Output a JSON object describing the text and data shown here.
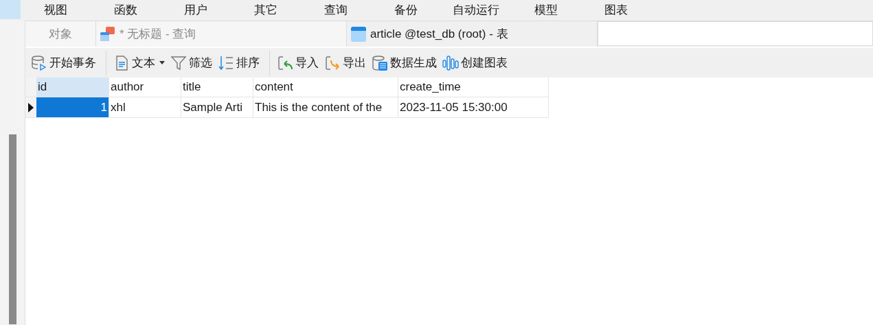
{
  "menu": [
    "视图",
    "函数",
    "用户",
    "其它",
    "查询",
    "备份",
    "自动运行",
    "模型",
    "图表"
  ],
  "tabs": [
    {
      "label": "对象",
      "kind": "plain",
      "selected": false
    },
    {
      "label": "* 无标题 - 查询",
      "kind": "query",
      "selected": false
    },
    {
      "label": "article @test_db (root) - 表",
      "kind": "table",
      "selected": true
    }
  ],
  "toolbar": [
    {
      "label": "开始事务",
      "kind": "transaction"
    },
    {
      "kind": "sep"
    },
    {
      "label": "文本",
      "kind": "text",
      "dropdown": true
    },
    {
      "label": "筛选",
      "kind": "filter"
    },
    {
      "label": "排序",
      "kind": "sort"
    },
    {
      "kind": "sep"
    },
    {
      "label": "导入",
      "kind": "import"
    },
    {
      "label": "导出",
      "kind": "export"
    },
    {
      "label": "数据生成",
      "kind": "generate"
    },
    {
      "label": "创建图表",
      "kind": "chart"
    }
  ],
  "table": {
    "columns": [
      {
        "label": "id",
        "selected": true
      },
      {
        "label": "author",
        "selected": false
      },
      {
        "label": "title",
        "selected": false
      },
      {
        "label": "content",
        "selected": false
      },
      {
        "label": "create_time",
        "selected": false
      }
    ],
    "rows": [
      {
        "current": true,
        "cells": [
          {
            "text": "1",
            "selected": true
          },
          {
            "text": "xhl",
            "selected": false
          },
          {
            "text": "Sample Arti",
            "selected": false
          },
          {
            "text": "This is the content of the",
            "selected": false
          },
          {
            "text": "2023-11-05 15:30:00",
            "selected": false
          }
        ]
      }
    ]
  }
}
